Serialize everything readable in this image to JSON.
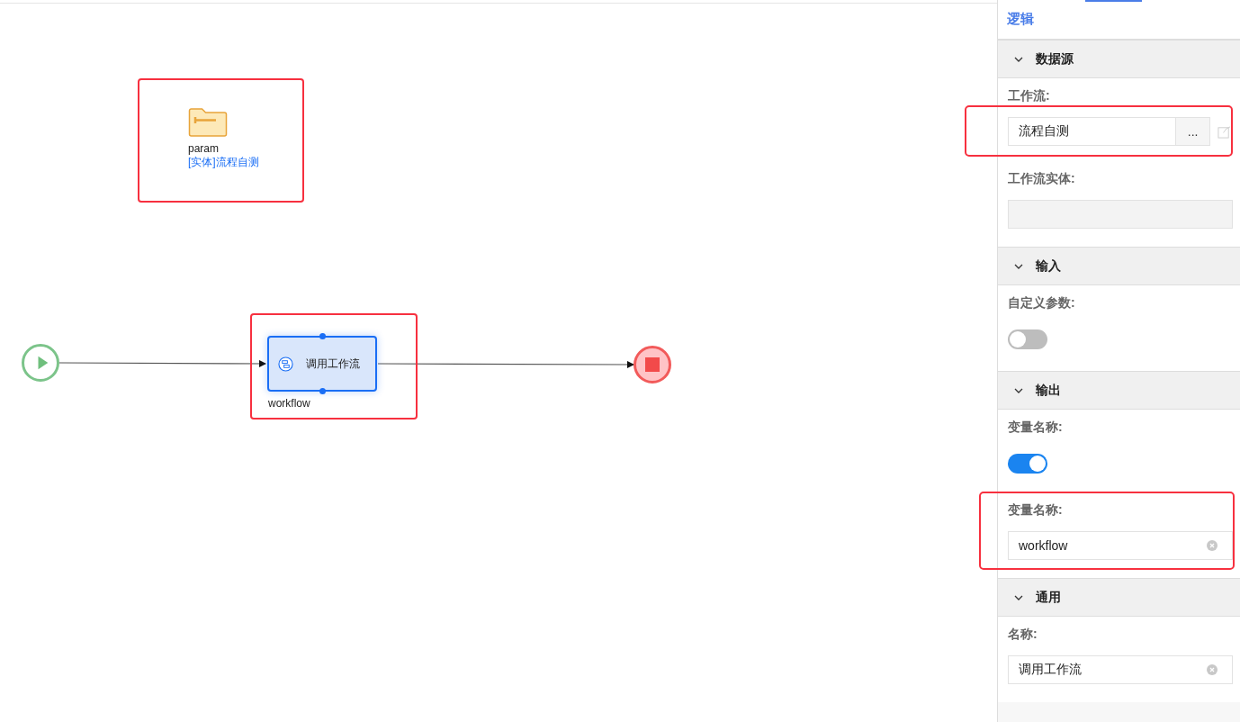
{
  "canvas": {
    "nodes": [
      {
        "kind": "param",
        "name": "param",
        "type": "[实体]流程自测",
        "highlighted": true
      },
      {
        "kind": "start"
      },
      {
        "kind": "task",
        "label": "调用工作流",
        "caption": "workflow",
        "selected": true,
        "highlighted": true
      },
      {
        "kind": "end"
      }
    ]
  },
  "panel": {
    "tab": {
      "label": "逻辑",
      "selected": true
    },
    "sections": [
      {
        "title": "数据源",
        "expanded": true,
        "fields": [
          {
            "kind": "picker",
            "label": "工作流:",
            "value": "流程自测",
            "button": "...",
            "highlighted": true
          },
          {
            "kind": "readonly",
            "label": "工作流实体:"
          }
        ]
      },
      {
        "title": "输入",
        "expanded": true,
        "fields": [
          {
            "kind": "switch",
            "label": "自定义参数:",
            "on": false
          }
        ]
      },
      {
        "title": "输出",
        "expanded": true,
        "fields": [
          {
            "kind": "switch",
            "label": "变量名称:",
            "on": true
          },
          {
            "kind": "text",
            "label": "变量名称:",
            "value": "workflow",
            "highlighted": true
          }
        ]
      },
      {
        "title": "通用",
        "expanded": true,
        "fields": [
          {
            "kind": "text",
            "label": "名称:",
            "value": "调用工作流"
          }
        ]
      }
    ]
  }
}
